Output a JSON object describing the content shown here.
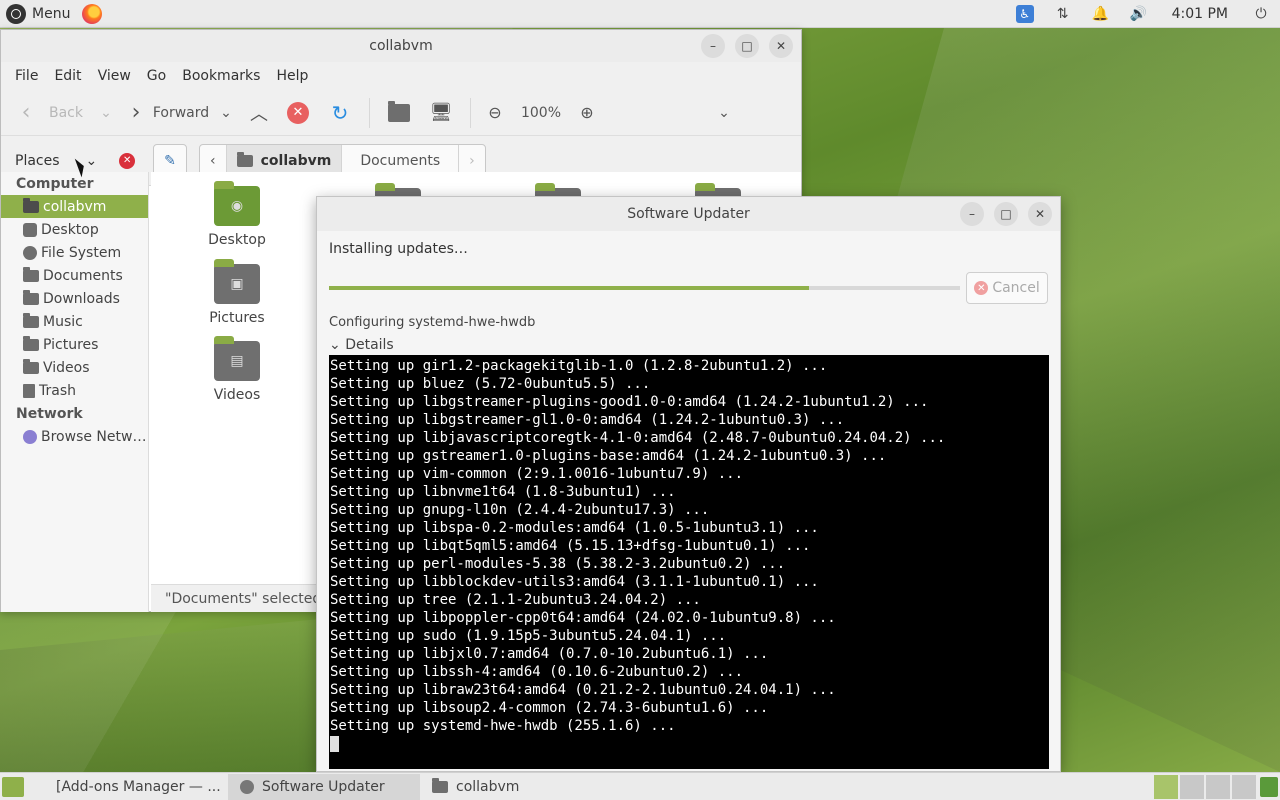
{
  "top_panel": {
    "menu_label": "Menu",
    "clock": "4:01 PM"
  },
  "file_manager": {
    "title": "collabvm",
    "menubar": [
      "File",
      "Edit",
      "View",
      "Go",
      "Bookmarks",
      "Help"
    ],
    "toolbar": {
      "back": "Back",
      "forward": "Forward",
      "zoom": "100%"
    },
    "places_label": "Places",
    "breadcrumb": [
      "collabvm",
      "Documents"
    ],
    "sidebar": {
      "computer_header": "Computer",
      "computer_items": [
        "collabvm",
        "Desktop",
        "File System",
        "Documents",
        "Downloads",
        "Music",
        "Pictures",
        "Videos",
        "Trash"
      ],
      "network_header": "Network",
      "network_items": [
        "Browse Netw…"
      ]
    },
    "content_items": [
      "Desktop",
      "Pictures",
      "Videos"
    ],
    "status": "\"Documents\" selected ("
  },
  "software_updater": {
    "title": "Software Updater",
    "installing": "Installing updates…",
    "progress": 0.76,
    "cancel": "Cancel",
    "configuring": "Configuring systemd-hwe-hwdb",
    "details": "Details",
    "terminal_lines": [
      "Setting up gir1.2-packagekitglib-1.0 (1.2.8-2ubuntu1.2) ...",
      "Setting up bluez (5.72-0ubuntu5.5) ...",
      "Setting up libgstreamer-plugins-good1.0-0:amd64 (1.24.2-1ubuntu1.2) ...",
      "Setting up libgstreamer-gl1.0-0:amd64 (1.24.2-1ubuntu0.3) ...",
      "Setting up libjavascriptcoregtk-4.1-0:amd64 (2.48.7-0ubuntu0.24.04.2) ...",
      "Setting up gstreamer1.0-plugins-base:amd64 (1.24.2-1ubuntu0.3) ...",
      "Setting up vim-common (2:9.1.0016-1ubuntu7.9) ...",
      "Setting up libnvme1t64 (1.8-3ubuntu1) ...",
      "Setting up gnupg-l10n (2.4.4-2ubuntu17.3) ...",
      "Setting up libspa-0.2-modules:amd64 (1.0.5-1ubuntu3.1) ...",
      "Setting up libqt5qml5:amd64 (5.15.13+dfsg-1ubuntu0.1) ...",
      "Setting up perl-modules-5.38 (5.38.2-3.2ubuntu0.2) ...",
      "Setting up libblockdev-utils3:amd64 (3.1.1-1ubuntu0.1) ...",
      "Setting up tree (2.1.1-2ubuntu3.24.04.2) ...",
      "Setting up libpoppler-cpp0t64:amd64 (24.02.0-1ubuntu9.8) ...",
      "Setting up sudo (1.9.15p5-3ubuntu5.24.04.1) ...",
      "Setting up libjxl0.7:amd64 (0.7.0-10.2ubuntu6.1) ...",
      "Setting up libssh-4:amd64 (0.10.6-2ubuntu0.2) ...",
      "Setting up libraw23t64:amd64 (0.21.2-2.1ubuntu0.24.04.1) ...",
      "Setting up libsoup2.4-common (2.74.3-6ubuntu1.6) ...",
      "Setting up systemd-hwe-hwdb (255.1.6) ..."
    ]
  },
  "taskbar": {
    "tasks": [
      "[Add-ons Manager — ...",
      "Software Updater",
      "collabvm"
    ]
  }
}
